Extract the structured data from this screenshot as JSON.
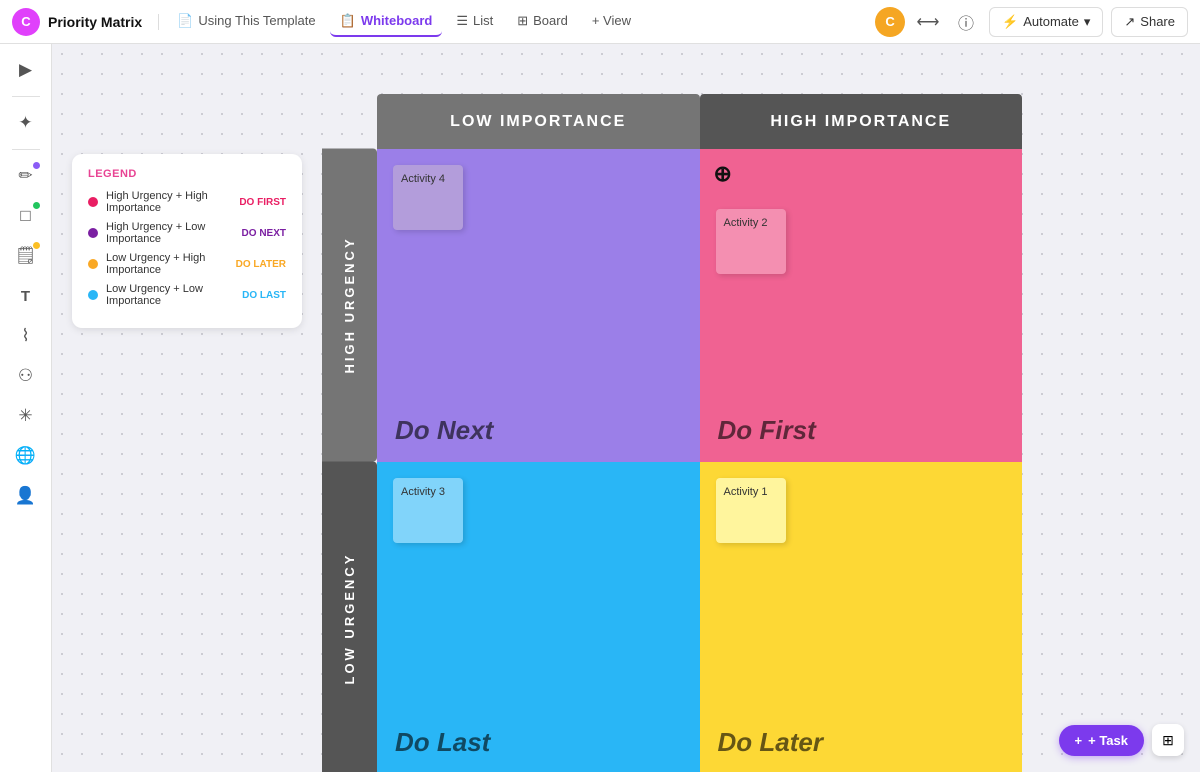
{
  "nav": {
    "logo": "C",
    "app_name": "Priority Matrix",
    "tabs": [
      {
        "id": "using-template",
        "label": "Using This Template",
        "icon": "📄",
        "active": false
      },
      {
        "id": "whiteboard",
        "label": "Whiteboard",
        "icon": "📋",
        "active": true
      },
      {
        "id": "list",
        "label": "List",
        "icon": "☰",
        "active": false
      },
      {
        "id": "board",
        "label": "Board",
        "icon": "⊞",
        "active": false
      },
      {
        "id": "view",
        "label": "+ View",
        "icon": "",
        "active": false
      }
    ],
    "automate_label": "Automate",
    "share_label": "Share",
    "user_avatar": "C"
  },
  "legend": {
    "title": "LEGEND",
    "items": [
      {
        "color": "#e91e63",
        "label": "High Urgency + High Importance",
        "action": "DO FIRST",
        "action_color": "#e91e63"
      },
      {
        "color": "#7b1fa2",
        "label": "High Urgency + Low Importance",
        "action": "DO NEXT",
        "action_color": "#7b1fa2"
      },
      {
        "color": "#f9a825",
        "label": "Low Urgency + High Importance",
        "action": "DO LATER",
        "action_color": "#f9a825"
      },
      {
        "color": "#29b6f6",
        "label": "Low Urgency + Low Importance",
        "action": "DO LAST",
        "action_color": "#29b6f6"
      }
    ]
  },
  "matrix": {
    "col_headers": [
      {
        "label": "LOW IMPORTANCE"
      },
      {
        "label": "HIGH IMPORTANCE"
      }
    ],
    "row_headers": [
      {
        "label": "HIGH URGENCY"
      },
      {
        "label": "LOW URGENCY"
      }
    ],
    "quadrants": [
      {
        "id": "do-next",
        "row": "high",
        "col": "low",
        "label": "Do Next",
        "bg": "#9b7fe8",
        "sticky": {
          "label": "Activity 4",
          "bg": "#b39ddb"
        }
      },
      {
        "id": "do-first",
        "row": "high",
        "col": "high",
        "label": "Do First",
        "bg": "#f06292",
        "sticky": {
          "label": "Activity 2",
          "bg": "#f48fb1"
        },
        "warning": true
      },
      {
        "id": "do-last",
        "row": "low",
        "col": "low",
        "label": "Do Last",
        "bg": "#29b6f6",
        "sticky": {
          "label": "Activity 3",
          "bg": "#81d4fa"
        }
      },
      {
        "id": "do-later",
        "row": "low",
        "col": "high",
        "label": "Do Later",
        "bg": "#fdd835",
        "sticky": {
          "label": "Activity 1",
          "bg": "#fff59d"
        }
      }
    ]
  },
  "add_task": "+ Task",
  "tools": [
    {
      "id": "select",
      "icon": "➤",
      "active": false,
      "dot": null
    },
    {
      "id": "ai",
      "icon": "✦",
      "active": false,
      "dot": null
    },
    {
      "id": "pen",
      "icon": "✏",
      "active": false,
      "dot": "#8b5cf6"
    },
    {
      "id": "shapes",
      "icon": "□",
      "active": false,
      "dot": "#22c55e"
    },
    {
      "id": "notes",
      "icon": "🗒",
      "active": false,
      "dot": "#fbbf24"
    },
    {
      "id": "text",
      "icon": "T",
      "active": false,
      "dot": null
    },
    {
      "id": "marker",
      "icon": "⌇",
      "active": false,
      "dot": null
    },
    {
      "id": "connect",
      "icon": "⚇",
      "active": false,
      "dot": null
    },
    {
      "id": "effects",
      "icon": "✳",
      "active": false,
      "dot": null
    },
    {
      "id": "globe",
      "icon": "🌐",
      "active": false,
      "dot": null
    },
    {
      "id": "image",
      "icon": "👤",
      "active": false,
      "dot": null
    }
  ]
}
